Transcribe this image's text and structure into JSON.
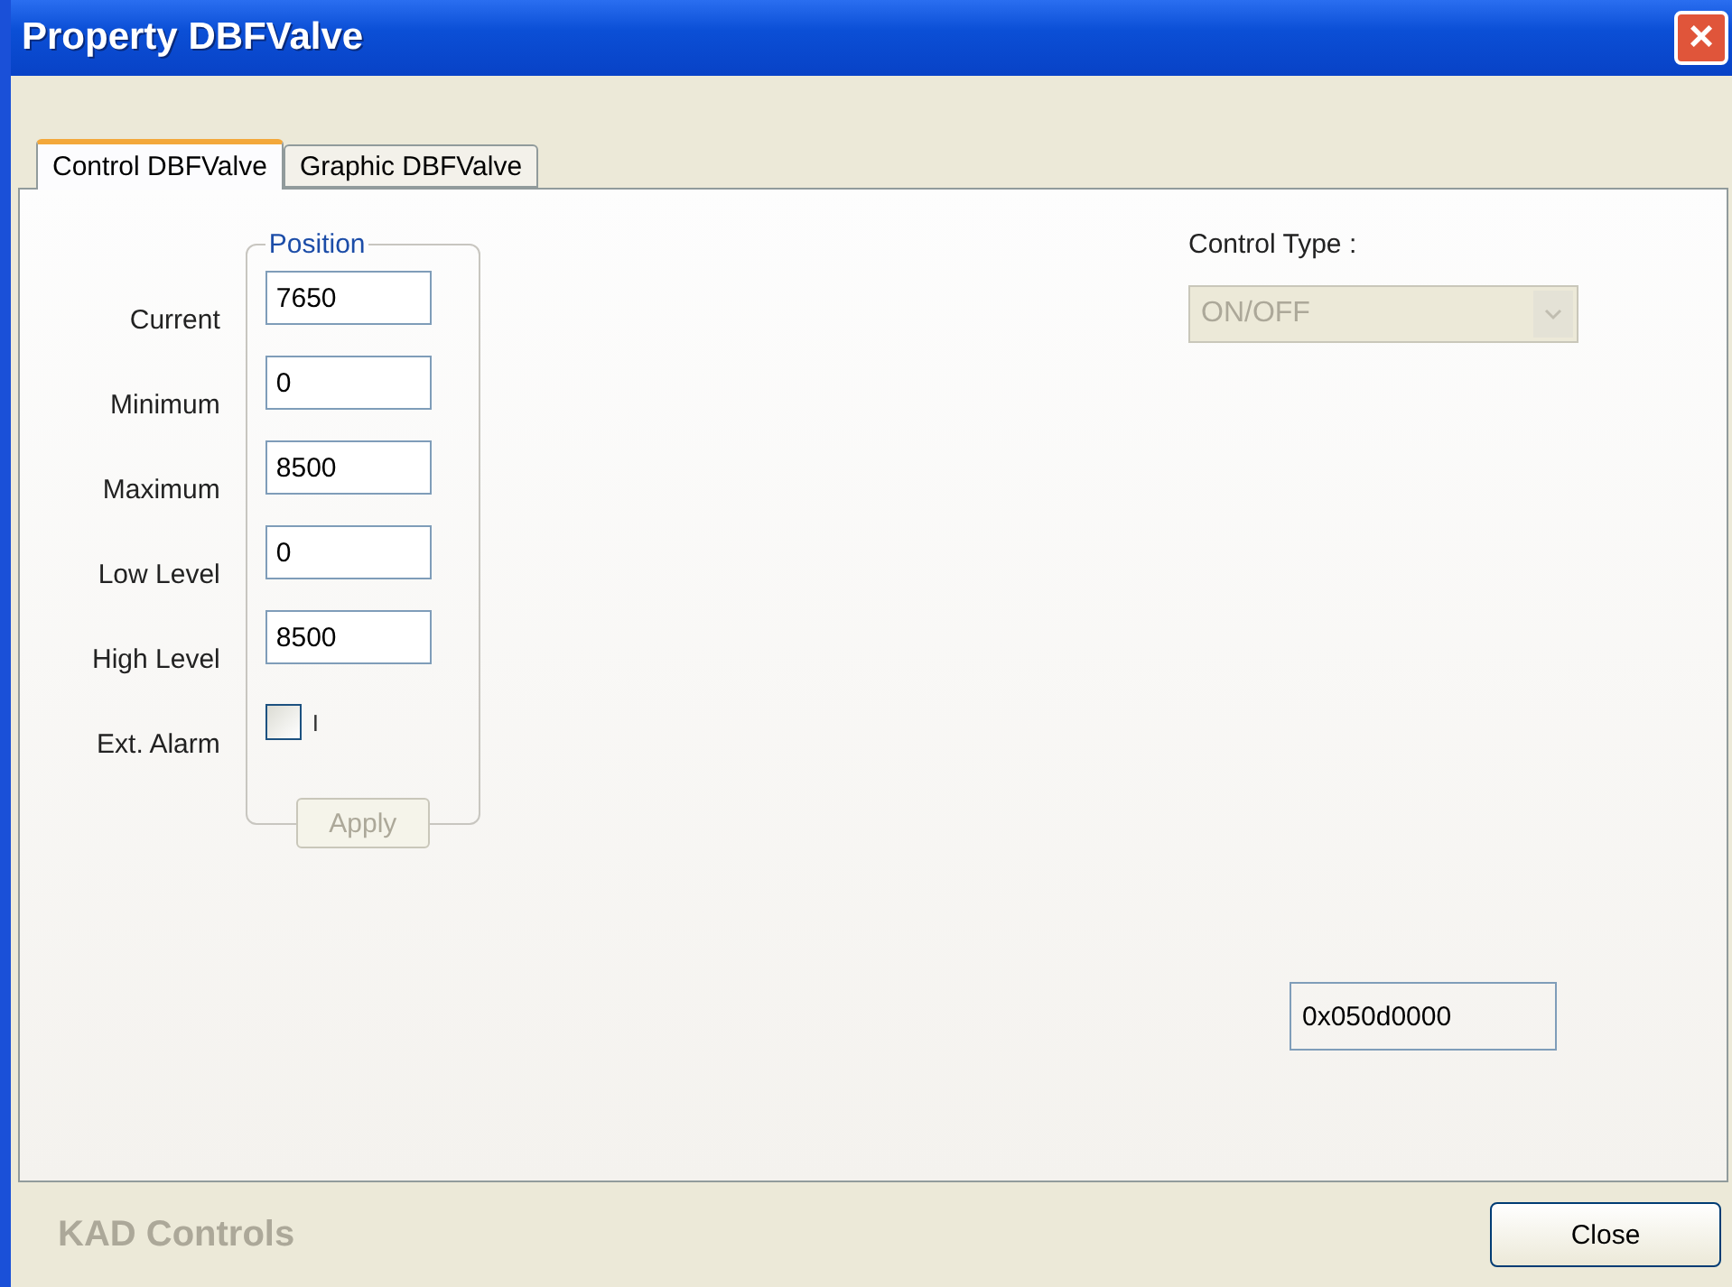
{
  "window": {
    "title": "Property DBFValve",
    "close": "×"
  },
  "tabs": [
    {
      "label": "Control DBFValve",
      "selected": true
    },
    {
      "label": "Graphic DBFValve",
      "selected": false
    }
  ],
  "position": {
    "legend": "Position",
    "fields": [
      {
        "kind": "text",
        "label": "Current",
        "value": "7650"
      },
      {
        "kind": "text",
        "label": "Minimum",
        "value": "0"
      },
      {
        "kind": "text",
        "label": "Maximum",
        "value": "8500"
      },
      {
        "kind": "text",
        "label": "Low Level",
        "value": "0"
      },
      {
        "kind": "text",
        "label": "High Level",
        "value": "8500"
      },
      {
        "kind": "checkbox",
        "label": "Ext. Alarm",
        "checked": false,
        "caption": "I"
      }
    ],
    "apply": {
      "label": "Apply",
      "disabled": true
    }
  },
  "control_type": {
    "label": "Control Type :",
    "value": "ON/OFF",
    "disabled": true
  },
  "handle": "0x050d0000",
  "footer": {
    "brand": "KAD Controls",
    "close": "Close"
  }
}
